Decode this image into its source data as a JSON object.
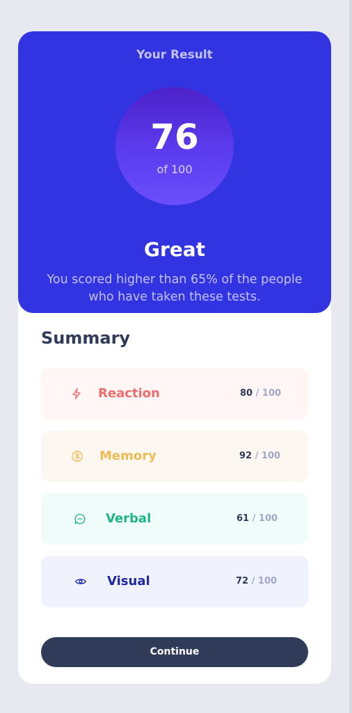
{
  "result": {
    "heading": "Your Result",
    "score": "76",
    "out_of": "of 100",
    "rating": "Great",
    "message": "You scored higher than 65% of the people who have taken these tests."
  },
  "summary": {
    "title": "Summary",
    "items": [
      {
        "label": "Reaction",
        "score": "80",
        "max": " / 100",
        "icon": "lightning-icon",
        "color": "#f06d6d",
        "bg": "#fff6f5"
      },
      {
        "label": "Memory",
        "score": "92",
        "max": " / 100",
        "icon": "brain-icon",
        "color": "#efbb55",
        "bg": "#fcf8f1"
      },
      {
        "label": "Verbal",
        "score": "61",
        "max": " / 100",
        "icon": "chat-icon",
        "color": "#1eb48a",
        "bg": "#f0fcf9"
      },
      {
        "label": "Visual",
        "score": "72",
        "max": " / 100",
        "icon": "eye-icon",
        "color": "#1e27a3",
        "bg": "#f0f2fd"
      }
    ]
  },
  "actions": {
    "continue_label": "Continue"
  },
  "colors": {
    "accent": "#3234e2",
    "dark": "#303b5a",
    "page_bg": "#e8e8f0"
  }
}
